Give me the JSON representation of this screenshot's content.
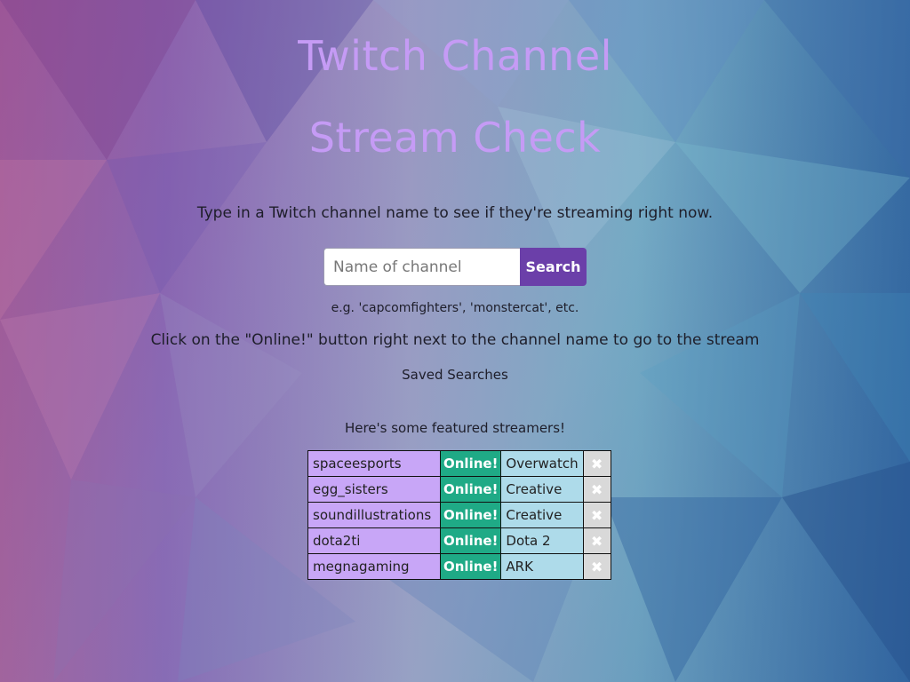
{
  "header": {
    "title_line1": "Twitch Channel",
    "title_line2": "Stream Check"
  },
  "intro_text": "Type in a Twitch channel name to see if they're streaming right now.",
  "search": {
    "placeholder": "Name of channel",
    "value": "",
    "button_label": "Search"
  },
  "example_text": "e.g. 'capcomfighters', 'monstercat', etc.",
  "instructions_text": "Click on the \"Online!\" button right next to the channel name to go to the stream",
  "saved_searches_label": "Saved Searches",
  "featured_label": "Here's some featured streamers!",
  "streams": [
    {
      "name": "spaceesports",
      "status": "Online!",
      "game": "Overwatch",
      "remove": "✖"
    },
    {
      "name": "egg_sisters",
      "status": "Online!",
      "game": "Creative",
      "remove": "✖"
    },
    {
      "name": "soundillustrations",
      "status": "Online!",
      "game": "Creative",
      "remove": "✖"
    },
    {
      "name": "dota2ti",
      "status": "Online!",
      "game": "Dota 2",
      "remove": "✖"
    },
    {
      "name": "megnagaming",
      "status": "Online!",
      "game": "ARK",
      "remove": "✖"
    }
  ],
  "colors": {
    "title": "#c59bf5",
    "search_button": "#6b3fa9",
    "name_cell": "#c8a6f7",
    "online_cell": "#1faa86",
    "game_cell": "#aedbea",
    "remove_cell": "#d9d9d9"
  }
}
